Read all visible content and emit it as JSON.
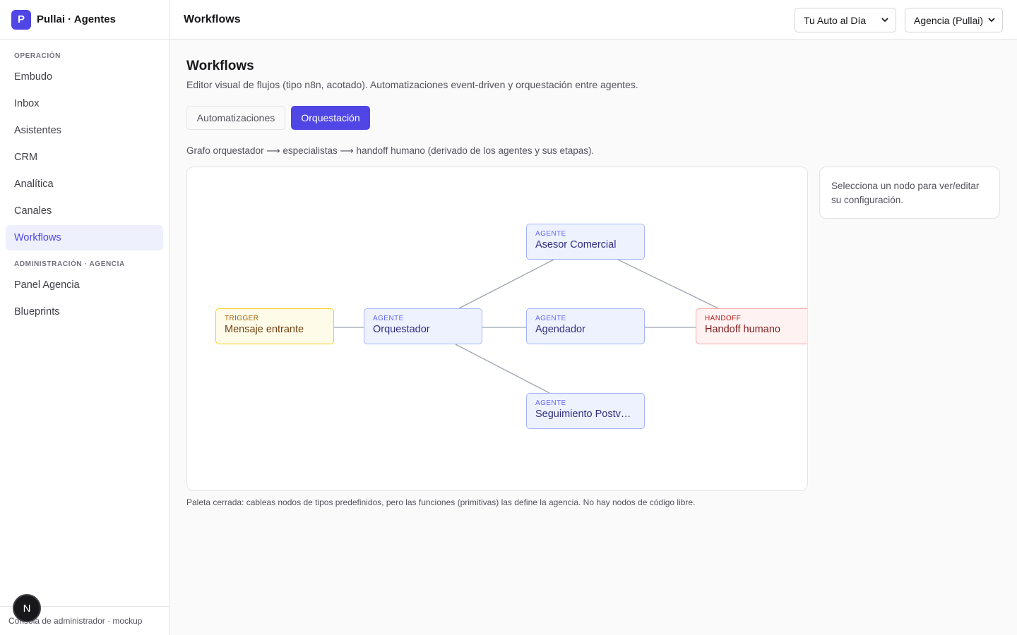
{
  "sidebar": {
    "brand_initial": "P",
    "brand_name": "Pullai · Agentes",
    "section_operation": "OPERACIÓN",
    "items_operation": [
      {
        "label": "Embudo"
      },
      {
        "label": "Inbox"
      },
      {
        "label": "Asistentes"
      },
      {
        "label": "CRM"
      },
      {
        "label": "Analítica"
      },
      {
        "label": "Canales"
      },
      {
        "label": "Workflows",
        "active": true
      }
    ],
    "section_admin": "ADMINISTRACIÓN · AGENCIA",
    "items_admin": [
      {
        "label": "Panel Agencia"
      },
      {
        "label": "Blueprints"
      }
    ],
    "footer": "Consola de administrador · mockup",
    "badge_letter": "N"
  },
  "topbar": {
    "title": "Workflows",
    "tenant_select": "Tu Auto al Día",
    "agency_select": "Agencia (Pullai)"
  },
  "main": {
    "title": "Workflows",
    "subtitle": "Editor visual de flujos (tipo n8n, acotado). Automatizaciones event-driven y orquestación entre agentes.",
    "tabs": [
      {
        "label": "Automatizaciones",
        "active": false
      },
      {
        "label": "Orquestación",
        "active": true
      }
    ],
    "graph_caption": "Grafo orquestador ⟶ especialistas ⟶ handoff humano (derivado de los agentes y sus etapas).",
    "nodes": [
      {
        "type": "TRIGGER",
        "name": "Mensaje entrante"
      },
      {
        "type": "AGENTE",
        "name": "Orquestador"
      },
      {
        "type": "AGENTE",
        "name": "Asesor Comercial"
      },
      {
        "type": "AGENTE",
        "name": "Agendador"
      },
      {
        "type": "AGENTE",
        "name": "Seguimiento Postventa"
      },
      {
        "type": "HANDOFF",
        "name": "Handoff humano"
      }
    ],
    "side_panel": "Selecciona un nodo para ver/editar su configuración.",
    "footnote": "Paleta cerrada: cableas nodos de tipos predefinidos, pero las funciones (primitivas) las define la agencia. No hay nodos de código libre."
  },
  "colors": {
    "accent": "#4f46e5",
    "trigger": "#facc15",
    "agent": "#a5b4fc",
    "handoff": "#fca5a5"
  }
}
